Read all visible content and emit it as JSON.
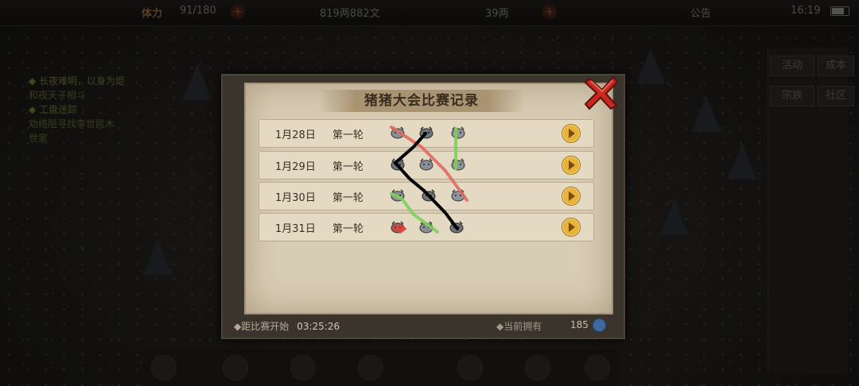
{
  "hud": {
    "stamina_label": "体力",
    "stamina_value": "91/180",
    "copper_value": "819两882文",
    "silver_value": "39两",
    "notice_label": "公告",
    "clock": "16:19"
  },
  "quests": [
    {
      "text": "◆ 长夜难明，以身为炬"
    },
    {
      "text": "和夜天子相斗"
    },
    {
      "text": "◆ 工盘迷踪"
    },
    {
      "text": "劝络阻寻找李世民木"
    },
    {
      "text": "世家"
    }
  ],
  "side_menu": [
    {
      "label": "活动"
    },
    {
      "label": "成本"
    },
    {
      "label": "宗族"
    },
    {
      "label": "社区"
    }
  ],
  "dialog": {
    "title": "猪猪大会比赛记录",
    "rows": [
      {
        "date": "1月28日",
        "round": "第一轮"
      },
      {
        "date": "1月29日",
        "round": "第一轮"
      },
      {
        "date": "1月30日",
        "round": "第一轮"
      },
      {
        "date": "1月31日",
        "round": "第一轮"
      }
    ],
    "footer_left_label": "◆距比赛开始",
    "footer_left_time": "03:25:26",
    "footer_right_label": "◆当前拥有",
    "footer_right_count": "185"
  },
  "colors": {
    "panel_bg": "#d7ccb4",
    "row_bg": "#e4dac3",
    "title_bar": "#a89472",
    "play_button": "#e7b43a",
    "close_red": "#c8281e",
    "line_red": "#e06a64",
    "line_green": "#7fcf5b",
    "line_black": "#000000"
  }
}
